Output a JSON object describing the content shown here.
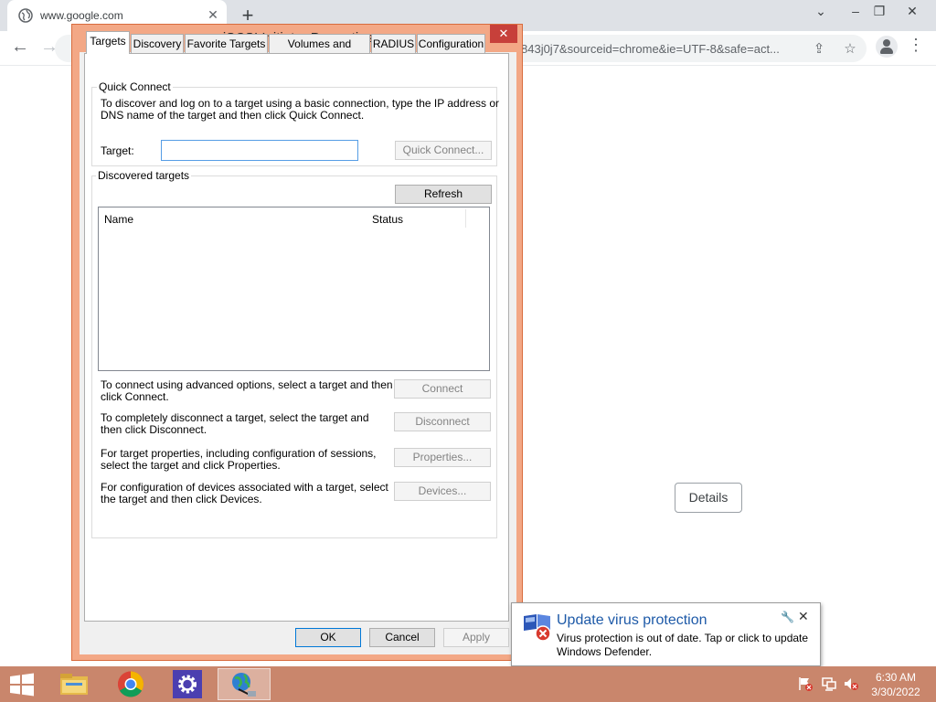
{
  "browser": {
    "tab_title": "www.google.com",
    "url": "843j0j7&sourceid=chrome&ie=UTF-8&safe=act...",
    "details_label": "Details"
  },
  "dialog": {
    "title": "iSCSI Initiator Properties",
    "tabs": [
      "Targets",
      "Discovery",
      "Favorite Targets",
      "Volumes and Devices",
      "RADIUS",
      "Configuration"
    ],
    "active_tab": "Targets",
    "quick_connect": {
      "group_title": "Quick Connect",
      "description_line1": "To discover and log on to a target using a basic connection, type the IP address or",
      "description_line2": "DNS name of the target and then click Quick Connect.",
      "target_label": "Target:",
      "target_value": "",
      "button": "Quick Connect..."
    },
    "discovered": {
      "group_title": "Discovered targets",
      "refresh_button": "Refresh",
      "columns": [
        "Name",
        "Status"
      ],
      "rows": []
    },
    "actions": [
      {
        "line1": "To connect using advanced options, select a target and then",
        "line2": "click Connect.",
        "button": "Connect"
      },
      {
        "line1": "To completely disconnect a target, select the target and",
        "line2": "then click Disconnect.",
        "button": "Disconnect"
      },
      {
        "line1": "For target properties, including configuration of sessions,",
        "line2": "select the target and click Properties.",
        "button": "Properties..."
      },
      {
        "line1": "For configuration of devices associated with a target, select",
        "line2": "the target and then click Devices.",
        "button": "Devices..."
      }
    ],
    "footer": {
      "ok": "OK",
      "cancel": "Cancel",
      "apply": "Apply"
    }
  },
  "notification": {
    "title": "Update virus protection",
    "message": "Virus protection is out of date. Tap or click to update Windows Defender."
  },
  "taskbar": {
    "items": [
      "start-button",
      "file-explorer-icon",
      "chrome-icon",
      "settings-icon",
      "iscsi-initiator-icon"
    ],
    "clock_time": "6:30 AM",
    "clock_date": "3/30/2022"
  },
  "colors": {
    "dialog_frame": "#f3a886",
    "close_button": "#c7403a",
    "taskbar": "#c9866c",
    "notification_title": "#1e5aa8"
  }
}
